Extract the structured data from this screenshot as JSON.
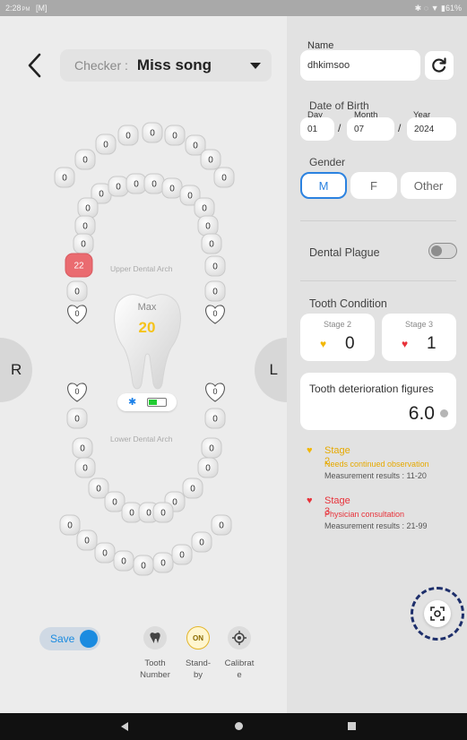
{
  "status_bar": {
    "time": "2:28",
    "ampm": "PM",
    "notification": "[M]",
    "battery": "61%"
  },
  "checker": {
    "label": "Checker :",
    "name": "Miss song"
  },
  "arches": {
    "upper_label": "Upper Dental Arch",
    "lower_label": "Lower Dental Arch",
    "upper_outer": [
      "0",
      "0",
      "0",
      "0",
      "0",
      "0",
      "0",
      "0",
      "0",
      "0"
    ],
    "upper_inner": [
      "0",
      "0",
      "0",
      "0",
      "0",
      "0",
      "0",
      "0",
      "0",
      "0",
      "0",
      "0",
      "0",
      "0",
      "0",
      "0",
      "22",
      "0",
      "0",
      "0",
      "0",
      "0",
      "0",
      "0"
    ],
    "lower_inner": [
      "0",
      "0",
      "0",
      "0",
      "0",
      "0",
      "0",
      "0",
      "0",
      "0",
      "0",
      "0",
      "0",
      "0",
      "0",
      "0",
      "0",
      "0",
      "0",
      "0",
      "0",
      "0",
      "0",
      "0"
    ],
    "lower_outer": [
      "0",
      "0",
      "0",
      "0",
      "0",
      "0",
      "0",
      "0",
      "0",
      "0"
    ]
  },
  "max": {
    "label": "Max",
    "value": "20"
  },
  "sides": {
    "right": "R",
    "left": "L"
  },
  "save": {
    "label": "Save",
    "on": true
  },
  "tools": [
    {
      "label": "Tooth\nNumber",
      "icon": "tooth-icon"
    },
    {
      "label": "Stand-\nby",
      "icon": "standby-on-icon",
      "badge": "ON"
    },
    {
      "label": "Calibrat\ne",
      "icon": "calibrate-icon"
    }
  ],
  "form": {
    "name_label": "Name",
    "name_value": "dhkimsoo",
    "dob_label": "Date of Birth",
    "day_label": "Day",
    "day_value": "01",
    "month_label": "Month",
    "month_value": "07",
    "year_label": "Year",
    "year_value": "2024",
    "separator": "/",
    "gender_label": "Gender",
    "gender_options": [
      "M",
      "F",
      "Other"
    ],
    "gender_selected": "M"
  },
  "dental_plague": {
    "label": "Dental Plague",
    "on": false
  },
  "tooth_condition": {
    "label": "Tooth Condition",
    "stage2_title": "Stage 2",
    "stage2_value": "0",
    "stage3_title": "Stage 3",
    "stage3_value": "1"
  },
  "figures": {
    "title": "Tooth deterioration figures",
    "value": "6.0"
  },
  "legend": [
    {
      "title": "Stage 2",
      "desc": "Needs continued observation",
      "range": "Measurement results : 11-20",
      "color": "#f2b705"
    },
    {
      "title": "Stage 3",
      "desc": "Physician consultation",
      "range": "Measurement results : 21-99",
      "color": "#e8323a"
    }
  ],
  "colors": {
    "accent": "#1a8be0",
    "stage2": "#f2b705",
    "stage3": "#e8323a",
    "highlight_tooth": "#ea6b70",
    "max": "#f5c31a"
  }
}
